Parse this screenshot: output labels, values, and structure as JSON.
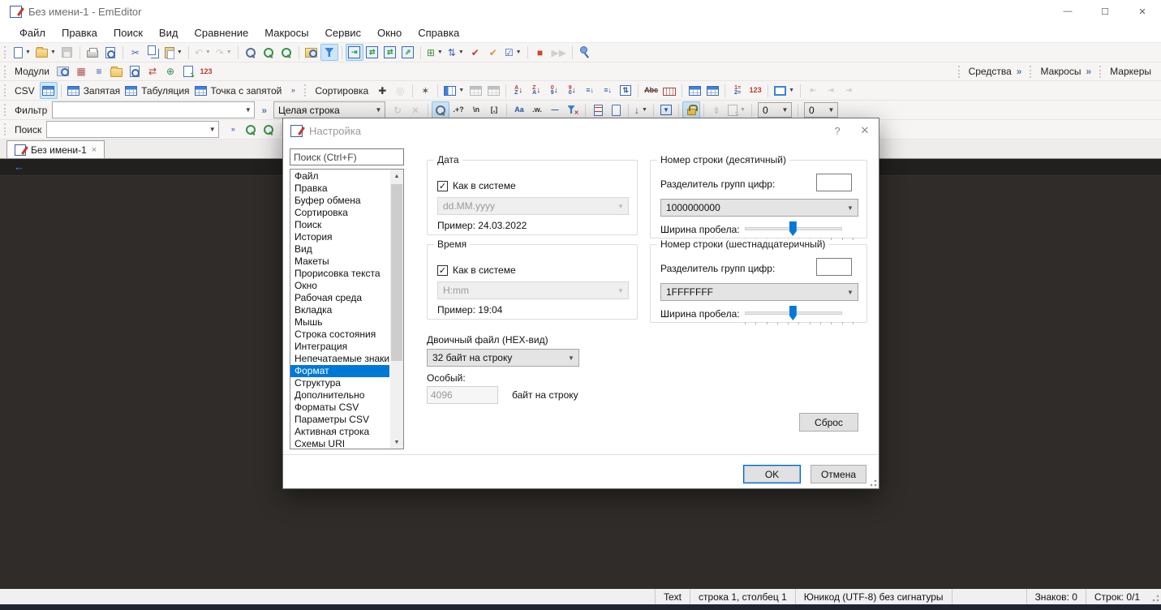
{
  "window": {
    "title": "Без имени-1 - EmEditor",
    "minimize": "—",
    "maximize": "☐",
    "close": "✕"
  },
  "menu": {
    "items": [
      "Файл",
      "Правка",
      "Поиск",
      "Вид",
      "Сравнение",
      "Макросы",
      "Сервис",
      "Окно",
      "Справка"
    ]
  },
  "toolbar_main": {
    "items": [
      {
        "grip": true
      },
      {
        "n": "new-file-button",
        "s": "doc",
        "dd": true
      },
      {
        "n": "open-file-button",
        "s": "folder",
        "dd": true
      },
      {
        "n": "save-button",
        "s": "floppy",
        "dis": true
      },
      {
        "sep": true
      },
      {
        "n": "print-button",
        "s": "printer"
      },
      {
        "n": "print-preview-button",
        "s": "docmag"
      },
      {
        "sep": true
      },
      {
        "n": "cut-button",
        "g": "✂",
        "c": "#3b68b8"
      },
      {
        "n": "copy-button",
        "s": "copy"
      },
      {
        "n": "paste-button",
        "s": "paste",
        "dd": true
      },
      {
        "sep": true
      },
      {
        "n": "undo-button",
        "g": "↶",
        "c": "#8f969e",
        "dd": true,
        "dis": true
      },
      {
        "n": "redo-button",
        "g": "↷",
        "c": "#8f969e",
        "dd": true,
        "dis": true
      },
      {
        "sep": true
      },
      {
        "n": "zoom-button",
        "s": "mag"
      },
      {
        "n": "find-previous-button",
        "s": "mag",
        "mod": "green"
      },
      {
        "n": "find-next-button",
        "s": "mag",
        "mod": "green"
      },
      {
        "sep": true
      },
      {
        "n": "find-in-files-button",
        "s": "foldermag"
      },
      {
        "n": "filter-toolbar-toggle",
        "s": "funnel",
        "act": true
      },
      {
        "sep": true
      },
      {
        "n": "no-wrap-button",
        "s": "wrap",
        "g2": "⇥",
        "act": true
      },
      {
        "n": "wrap-by-char-button",
        "s": "wrap",
        "g2": "⇄"
      },
      {
        "n": "wrap-by-window-button",
        "s": "wrap",
        "g2": "⇄"
      },
      {
        "n": "wrap-by-page-button",
        "s": "wrap",
        "g2": "⇗"
      },
      {
        "sep": true
      },
      {
        "n": "outline-button",
        "g": "⊞",
        "c": "#3f8f3f",
        "dd": true
      },
      {
        "n": "sync-scroll-button",
        "g": "⇅",
        "c": "#3b68b8",
        "dd": true
      },
      {
        "n": "compare-button",
        "g": "✔",
        "c": "#c0392b"
      },
      {
        "n": "compare-rescan-button",
        "g": "✔",
        "c": "#d9913d"
      },
      {
        "n": "validate-button",
        "g": "☑",
        "c": "#2458a8",
        "dd": true
      },
      {
        "sep": true
      },
      {
        "n": "record-macro-button",
        "g": "■",
        "c": "#cf4431"
      },
      {
        "n": "run-macro-button",
        "g": "▶▶",
        "c": "#9aa0a6",
        "dis": true
      },
      {
        "sep": true
      },
      {
        "n": "pin-button",
        "s": "pin"
      }
    ]
  },
  "toolbar_modules": {
    "label": "Модули",
    "items": [
      {
        "grip": true
      },
      {
        "lblonly": "Модули"
      },
      {
        "n": "modules-explorer-button",
        "s": "boxmag"
      },
      {
        "n": "modules-converter-button",
        "g": "▦",
        "c": "#b05050"
      },
      {
        "n": "modules-outline-text-button",
        "g": "≡",
        "c": "#2458a8"
      },
      {
        "n": "modules-projects-button",
        "s": "folder"
      },
      {
        "n": "modules-search-button",
        "s": "docmag"
      },
      {
        "n": "modules-diff-button",
        "g": "⇄",
        "c": "#c0392b"
      },
      {
        "n": "modules-web-preview-button",
        "g": "⊕",
        "c": "#2e8b57"
      },
      {
        "n": "modules-export-button",
        "s": "docexport"
      },
      {
        "n": "modules-word-count-button",
        "t": "123",
        "c": "#c0392b"
      }
    ]
  },
  "dock_right": {
    "tools_label": "Средства",
    "macros_label": "Макросы",
    "markers_label": "Маркеры",
    "chevron": "»"
  },
  "toolbar_csv": {
    "items": [
      {
        "grip": true
      },
      {
        "lblonly": "CSV"
      },
      {
        "n": "csv-mode-button",
        "s": "table",
        "act": true
      },
      {
        "sep": true
      },
      {
        "n": "csv-comma-button",
        "s": "table",
        "lbl": "Запятая"
      },
      {
        "n": "csv-tab-button",
        "s": "table",
        "lbl": "Табуляция"
      },
      {
        "n": "csv-semicolon-button",
        "s": "table",
        "lbl": "Точка с запятой"
      },
      {
        "n": "csv-overflow-chevron",
        "t": "»",
        "c": "#5a7aa5"
      },
      {
        "grip": true
      },
      {
        "lblonly": "Сортировка"
      },
      {
        "n": "sort-add-button",
        "g": "✚",
        "c": "#3a3a3a"
      },
      {
        "n": "sort-options-button",
        "g": "◎",
        "c": "#8f969e",
        "dis": true
      },
      {
        "sep": true
      },
      {
        "n": "sort-wizard-button",
        "g": "✶",
        "c": "#5a5a5a"
      },
      {
        "sep": true
      },
      {
        "n": "select-columns-button",
        "s": "cols",
        "dd": true
      },
      {
        "n": "delete-columns-button",
        "s": "table",
        "dis": true
      },
      {
        "n": "insert-column-button",
        "s": "table",
        "dis": true
      },
      {
        "sep": true
      },
      {
        "n": "sort-az-button",
        "stack": [
          "A",
          "Z"
        ],
        "arrow": "↓"
      },
      {
        "n": "sort-za-button",
        "stack": [
          "Z",
          "A"
        ],
        "arrow": "↓"
      },
      {
        "n": "sort-num-asc-button",
        "stack": [
          "0",
          "9"
        ],
        "arrow": "↓"
      },
      {
        "n": "sort-num-desc-button",
        "stack": [
          "9",
          "0"
        ],
        "arrow": "↓"
      },
      {
        "n": "sort-length-asc-button",
        "t": "≡↓",
        "c": "#2458a8"
      },
      {
        "n": "sort-length-desc-button",
        "t": "≡↓",
        "c": "#2458a8"
      },
      {
        "n": "sort-reverse-button",
        "t": "⇅",
        "c": "#2458a8",
        "box": true
      },
      {
        "sep": true
      },
      {
        "n": "delete-duplicates-button",
        "t": "Abc",
        "c": "#333",
        "strike": true
      },
      {
        "n": "csv-ruler-button",
        "s": "ruler"
      },
      {
        "sep": true
      },
      {
        "n": "csv-join-button",
        "s": "table2"
      },
      {
        "n": "csv-unpivot-button",
        "s": "tablearr"
      },
      {
        "sep": true
      },
      {
        "n": "line-numbers-button",
        "stack": [
          "1=",
          "2="
        ]
      },
      {
        "n": "column-digits-button",
        "t": "123",
        "c": "#c0392b"
      },
      {
        "sep": true
      },
      {
        "n": "cell-borders-button",
        "s": "border",
        "dd": true
      },
      {
        "sep": true
      },
      {
        "n": "move-column-left-button",
        "t": "⇤",
        "c": "#8f969e",
        "dis": true
      },
      {
        "n": "move-column-right-button",
        "t": "⇥",
        "c": "#8f969e",
        "dis": true
      },
      {
        "n": "fit-columns-button",
        "t": "⇥",
        "c": "#8f969e",
        "dis": true
      }
    ]
  },
  "filter_bar": {
    "label": "Фильтр",
    "input_value": "",
    "match_mode": "Целая строка",
    "count_1": "0",
    "count_2": "0",
    "items": [
      {
        "n": "filter-refresh-button",
        "g": "↻",
        "c": "#8f969e",
        "dis": true
      },
      {
        "n": "filter-close-button",
        "g": "✕",
        "c": "#8f969e",
        "dis": true
      },
      {
        "sep": true
      },
      {
        "n": "filter-apply-button",
        "s": "mag",
        "act": true
      },
      {
        "n": "filter-regex-button",
        "t": ".+?",
        "c": "#333"
      },
      {
        "n": "filter-escape-button",
        "t": "\\n",
        "c": "#333"
      },
      {
        "n": "filter-csv-scope-button",
        "t": "[,]",
        "c": "#333"
      },
      {
        "sep": true
      },
      {
        "n": "match-case-button",
        "t": "Aa",
        "c": "#2458a8"
      },
      {
        "n": "whole-word-button",
        "t": ".w.",
        "c": "#333"
      },
      {
        "n": "negative-filter-button",
        "t": "—",
        "c": "#2458a8"
      },
      {
        "n": "exclude-filter-button",
        "s": "funnelx"
      },
      {
        "sep": true
      },
      {
        "n": "bookmark-matches-button",
        "s": "doclines"
      },
      {
        "n": "extract-matches-button",
        "s": "doc"
      },
      {
        "sep": true
      },
      {
        "n": "filter-direction-button",
        "g": "↓",
        "c": "#2458a8",
        "dd": true
      },
      {
        "sep": true
      },
      {
        "n": "filter-table-button",
        "s": "tbox"
      },
      {
        "sep": true
      },
      {
        "n": "lock-button",
        "s": "lock",
        "act": true
      },
      {
        "sep": true
      },
      {
        "n": "follow-cursor-button",
        "g": "⇟",
        "c": "#8f969e",
        "dis": true
      },
      {
        "n": "filter-output-button",
        "s": "docexport",
        "dd": true,
        "dis": true
      },
      {
        "sep": true
      },
      {
        "n": "filter-count-combo",
        "combo": "0"
      },
      {
        "sep": true
      },
      {
        "n": "filter-level-combo",
        "combo": "0"
      }
    ]
  },
  "search_bar": {
    "label": "Поиск",
    "input_value": "",
    "items": [
      {
        "n": "search-overflow-chevron",
        "t": "»",
        "c": "#5a7aa5"
      },
      {
        "n": "search-previous-button",
        "s": "mag",
        "mod": "green"
      },
      {
        "n": "search-next-button",
        "s": "mag",
        "mod": "green"
      },
      {
        "sep": true
      },
      {
        "n": "search-highlight-button",
        "s": "mag",
        "act": true
      }
    ]
  },
  "tab": {
    "title": "Без имени-1",
    "close": "×"
  },
  "editor": {
    "eof_marker": "←"
  },
  "dialog": {
    "title": "Настройка",
    "help": "?",
    "close": "✕",
    "search_placeholder": "Поиск (Ctrl+F)",
    "categories": [
      "Файл",
      "Правка",
      "Буфер обмена",
      "Сортировка",
      "Поиск",
      "История",
      "Вид",
      "Макеты",
      "Прорисовка текста",
      "Окно",
      "Рабочая среда",
      "Вкладка",
      "Мышь",
      "Строка состояния",
      "Интеграция",
      "Непечатаемые знаки",
      "Формат",
      "Структура",
      "Дополнительно",
      "Форматы CSV",
      "Параметры CSV",
      "Активная строка",
      "Схемы URI"
    ],
    "selected_category": "Формат",
    "date_group": {
      "title": "Дата",
      "checkbox_label": "Как в системе",
      "checked": true,
      "format": "dd.MM.yyyy",
      "example": "Пример: 24.03.2022"
    },
    "time_group": {
      "title": "Время",
      "checkbox_label": "Как в системе",
      "checked": true,
      "format": "H:mm",
      "example": "Пример: 19:04"
    },
    "hex_section": {
      "title": "Двоичный файл (HEX-вид)",
      "bytes_per_line": "32 байт на строку",
      "custom_label": "Особый:",
      "custom_value": "4096",
      "custom_suffix": "байт на строку"
    },
    "line_dec_group": {
      "title": "Номер строки (десятичный)",
      "separator_label": "Разделитель групп цифр:",
      "separator_value": "",
      "sample": "1000000000",
      "slider_label": "Ширина пробела:",
      "slider_percent": 49
    },
    "line_hex_group": {
      "title": "Номер строки (шестнадцатеричный)",
      "separator_label": "Разделитель групп цифр:",
      "separator_value": "",
      "sample": "1FFFFFFF",
      "slider_label": "Ширина пробела:",
      "slider_percent": 49
    },
    "reset_button": "Сброс",
    "ok_button": "OK",
    "cancel_button": "Отмена"
  },
  "status_bar": {
    "segments": [
      {
        "n": "status-mode",
        "t": "Text"
      },
      {
        "n": "status-position",
        "t": "строка 1, столбец 1"
      },
      {
        "n": "status-encoding",
        "t": "Юникод (UTF-8) без сигнатуры"
      },
      {
        "n": "status-blank",
        "t": ""
      },
      {
        "n": "status-chars",
        "t": "Знаков: 0"
      },
      {
        "n": "status-lines",
        "t": "Строк: 0/1"
      }
    ]
  }
}
